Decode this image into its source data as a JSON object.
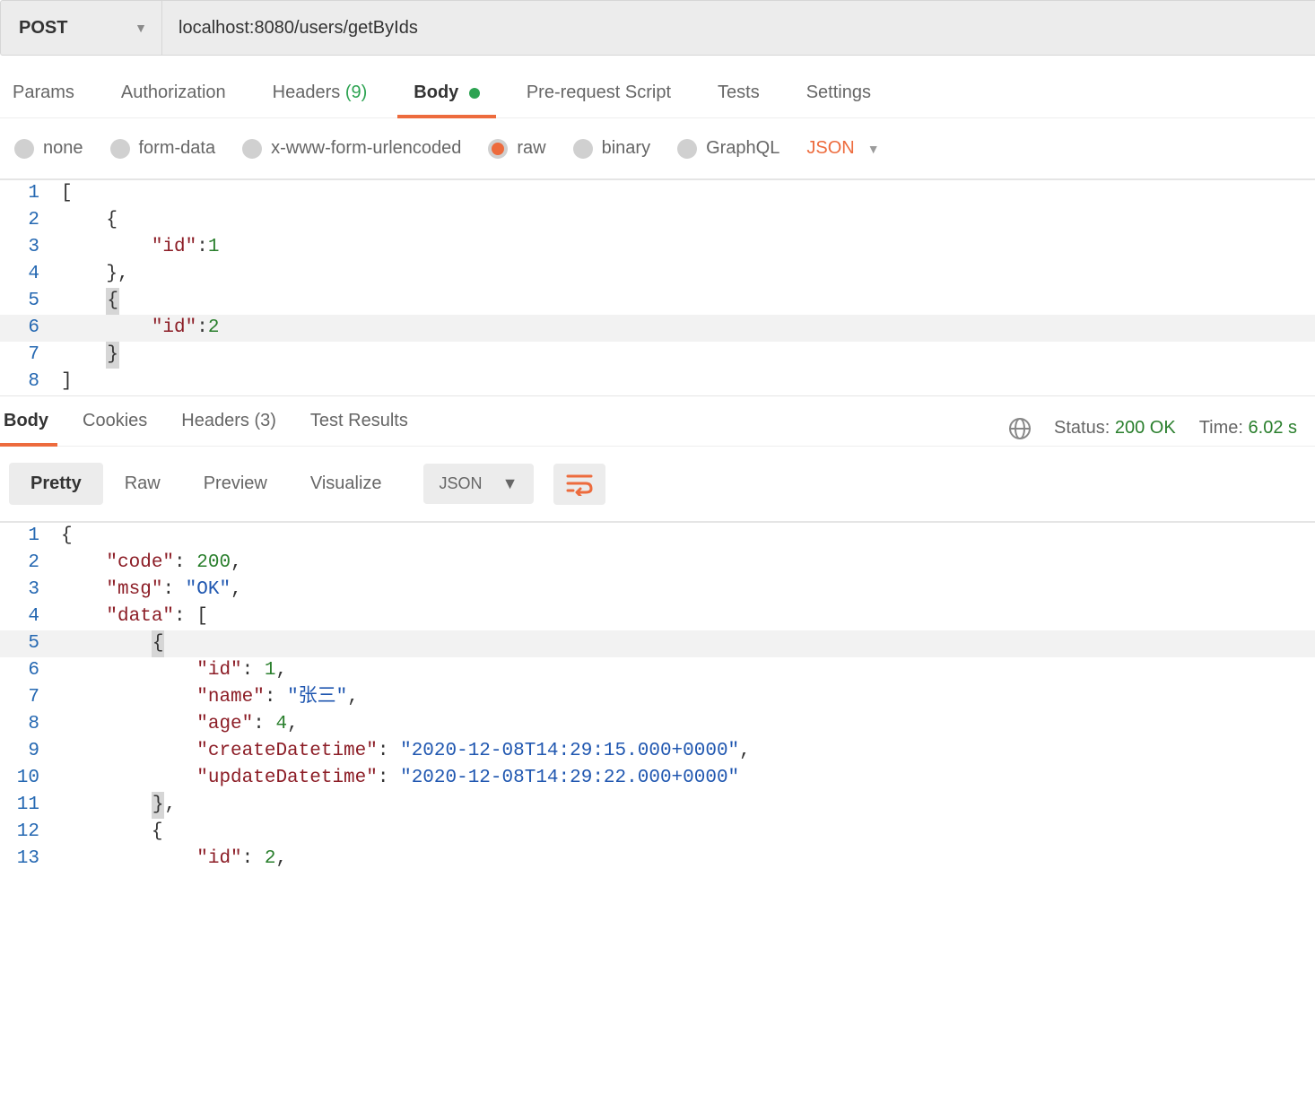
{
  "request": {
    "method": "POST",
    "url": "localhost:8080/users/getByIds"
  },
  "tabs": {
    "params": "Params",
    "authorization": "Authorization",
    "headers_label": "Headers",
    "headers_count": "(9)",
    "body": "Body",
    "pre_request": "Pre-request Script",
    "tests": "Tests",
    "settings": "Settings"
  },
  "body_options": {
    "none": "none",
    "form_data": "form-data",
    "urlencoded": "x-www-form-urlencoded",
    "raw": "raw",
    "binary": "binary",
    "graphql": "GraphQL",
    "format": "JSON"
  },
  "request_body_lines": {
    "l1": "[",
    "l2_open": "    {",
    "l3_key": "\"id\"",
    "l3_val": "1",
    "l4": "    },",
    "l5_open": "    {",
    "l6_key": "\"id\"",
    "l6_val": "2",
    "l7": "    }",
    "l8": "]"
  },
  "response_tabs": {
    "body": "Body",
    "cookies": "Cookies",
    "headers_label": "Headers",
    "headers_count": "(3)",
    "test_results": "Test Results"
  },
  "response_meta": {
    "status_label": "Status:",
    "status_value": "200 OK",
    "time_label": "Time:",
    "time_value": "6.02 s"
  },
  "view_modes": {
    "pretty": "Pretty",
    "raw": "Raw",
    "preview": "Preview",
    "visualize": "Visualize",
    "format": "JSON"
  },
  "response_body": {
    "l1": "{",
    "l2_key": "\"code\"",
    "l2_val": "200",
    "l3_key": "\"msg\"",
    "l3_val": "\"OK\"",
    "l4_key": "\"data\"",
    "l5_open": "        {",
    "l6_key": "\"id\"",
    "l6_val": "1",
    "l7_key": "\"name\"",
    "l7_val": "\"张三\"",
    "l8_key": "\"age\"",
    "l8_val": "4",
    "l9_key": "\"createDatetime\"",
    "l9_val": "\"2020-12-08T14:29:15.000+0000\"",
    "l10_key": "\"updateDatetime\"",
    "l10_val": "\"2020-12-08T14:29:22.000+0000\"",
    "l11": "        },",
    "l12": "        {",
    "l13_key": "\"id\"",
    "l13_val": "2"
  },
  "ln": {
    "n1": "1",
    "n2": "2",
    "n3": "3",
    "n4": "4",
    "n5": "5",
    "n6": "6",
    "n7": "7",
    "n8": "8",
    "n9": "9",
    "n10": "10",
    "n11": "11",
    "n12": "12",
    "n13": "13"
  }
}
